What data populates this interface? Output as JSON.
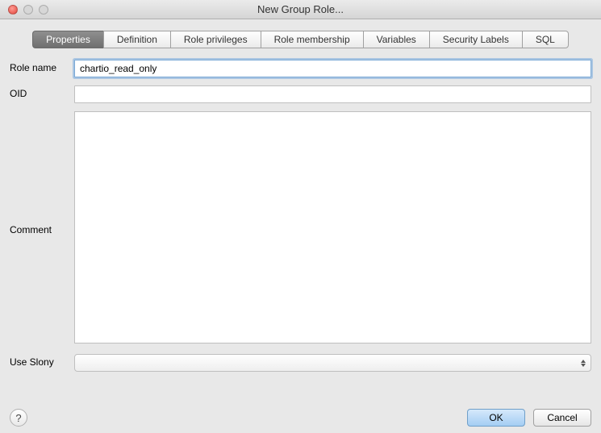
{
  "window": {
    "title": "New Group Role..."
  },
  "tabs": {
    "properties": "Properties",
    "definition": "Definition",
    "role_privileges": "Role privileges",
    "role_membership": "Role membership",
    "variables": "Variables",
    "security_labels": "Security Labels",
    "sql": "SQL"
  },
  "labels": {
    "role_name": "Role name",
    "oid": "OID",
    "comment": "Comment",
    "use_slony": "Use Slony"
  },
  "values": {
    "role_name": "chartio_read_only",
    "oid": "",
    "comment": "",
    "use_slony": ""
  },
  "footer": {
    "help": "?",
    "ok": "OK",
    "cancel": "Cancel"
  }
}
